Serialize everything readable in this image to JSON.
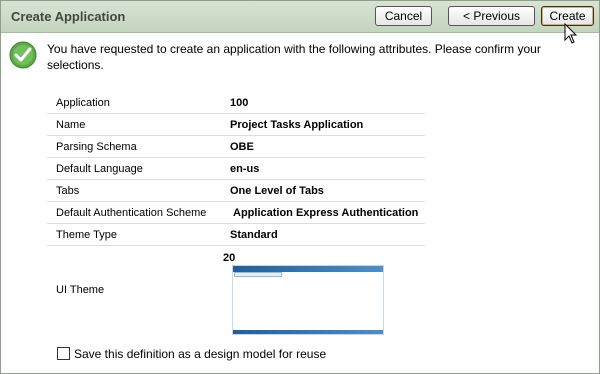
{
  "header": {
    "title": "Create Application",
    "cancel_label": "Cancel",
    "previous_label": "< Previous",
    "create_label": "Create"
  },
  "intro_text": "You have requested to create an application with the following attributes. Please confirm your selections.",
  "attributes": [
    {
      "label": "Application",
      "value": "100"
    },
    {
      "label": "Name",
      "value": "Project Tasks Application"
    },
    {
      "label": "Parsing Schema",
      "value": "OBE"
    },
    {
      "label": "Default Language",
      "value": "en-us"
    },
    {
      "label": "Tabs",
      "value": "One Level of Tabs"
    },
    {
      "label": "Default Authentication Scheme",
      "value": "Application Express Authentication"
    },
    {
      "label": "Theme Type",
      "value": "Standard"
    }
  ],
  "ui_theme": {
    "label": "UI Theme",
    "value": "20"
  },
  "save_option_label": "Save this definition as a design model for reuse",
  "colors": {
    "header_bg": "#c3d4bf",
    "accent_blue": "#1f5f9c",
    "check_green": "#4a9a3c"
  }
}
